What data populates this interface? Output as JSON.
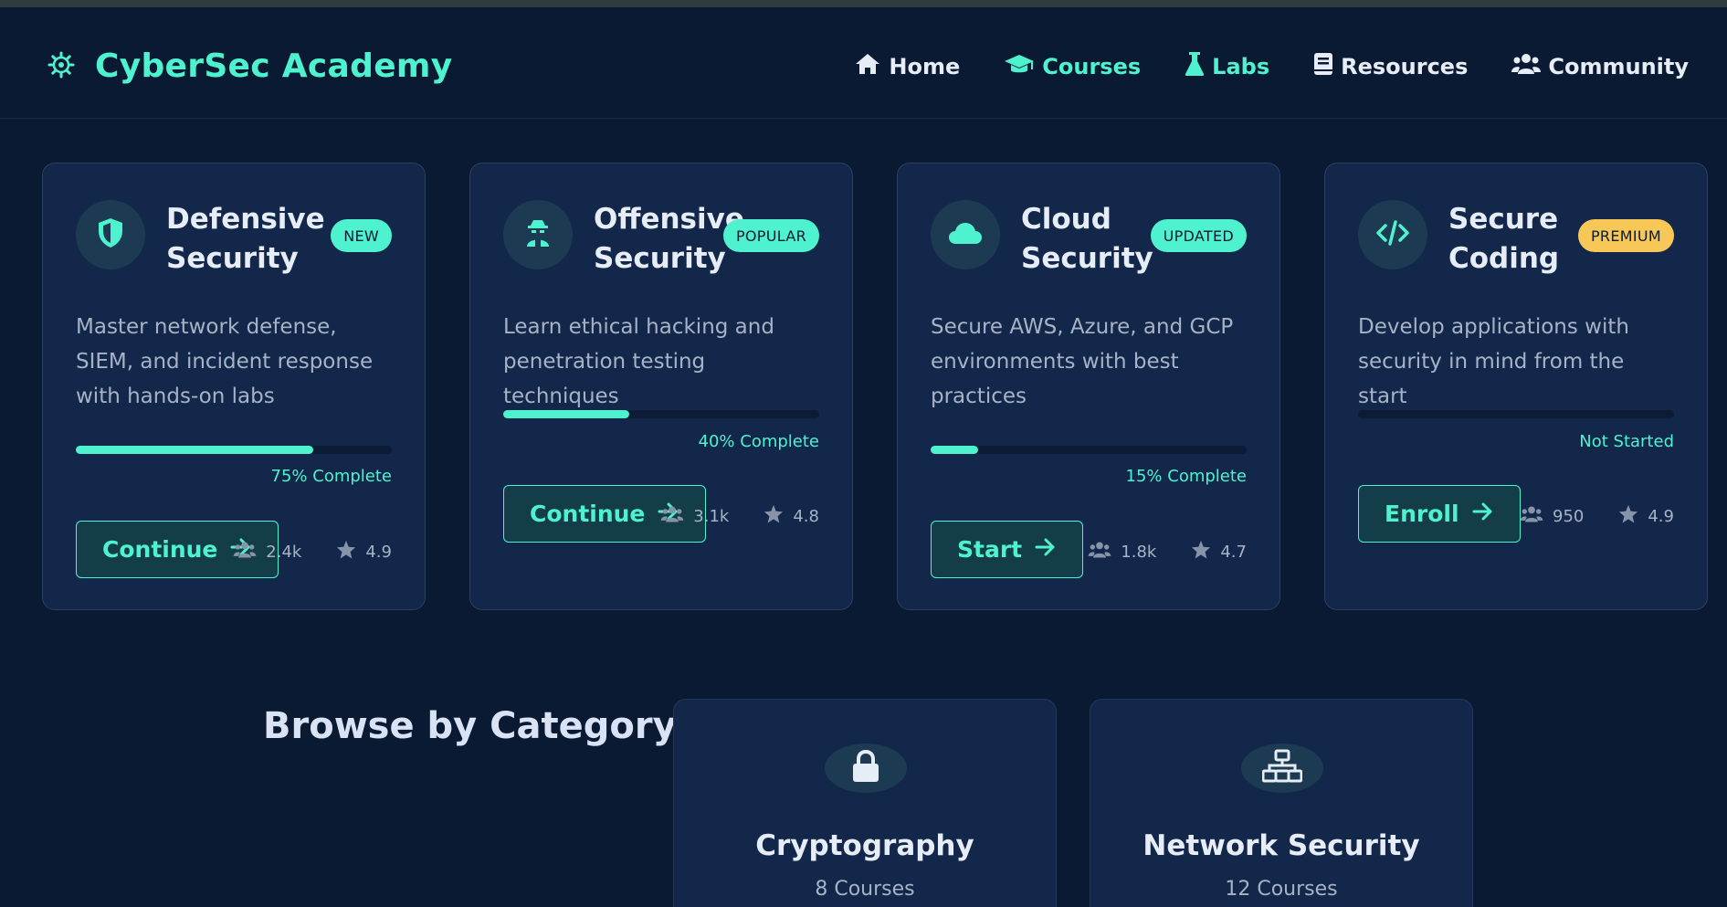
{
  "brand": {
    "title": "CyberSec Academy",
    "icon": "gear-icon"
  },
  "nav": [
    {
      "label": "Home",
      "icon": "home-icon",
      "active": false
    },
    {
      "label": "Courses",
      "icon": "graduation-cap-icon",
      "active": true
    },
    {
      "label": "Labs",
      "icon": "flask-icon",
      "active": true
    },
    {
      "label": "Resources",
      "icon": "book-icon",
      "active": false
    },
    {
      "label": "Community",
      "icon": "users-icon",
      "active": false
    }
  ],
  "courses": [
    {
      "title": "Defensive Security",
      "badge": "NEW",
      "icon": "shield-icon",
      "description": "Master network defense, SIEM, and incident response with hands-on labs",
      "progress": 0.75,
      "progress_label": "75% Complete",
      "button_label": "Continue",
      "students": "2.4k",
      "rating": "4.9"
    },
    {
      "title": "Offensive Security",
      "badge": "POPULAR",
      "icon": "hacker-icon",
      "description": "Learn ethical hacking and penetration testing techniques",
      "progress": 0.4,
      "progress_label": "40% Complete",
      "button_label": "Continue",
      "students": "3.1k",
      "rating": "4.8"
    },
    {
      "title": "Cloud Security",
      "badge": "UPDATED",
      "icon": "cloud-icon",
      "description": "Secure AWS, Azure, and GCP environments with best practices",
      "progress": 0.15,
      "progress_label": "15% Complete",
      "button_label": "Start",
      "students": "1.8k",
      "rating": "4.7"
    },
    {
      "title": "Secure Coding",
      "badge": "PREMIUM",
      "icon": "code-icon",
      "description": "Develop applications with security in mind from the start",
      "progress": 0,
      "progress_label": "Not Started",
      "button_label": "Enroll",
      "students": "950",
      "rating": "4.9"
    }
  ],
  "categories_section": {
    "title": "Browse by Category"
  },
  "categories": [
    {
      "name": "Cryptography",
      "count": "8 Courses",
      "icon": "lock-icon"
    },
    {
      "name": "Network Security",
      "count": "12 Courses",
      "icon": "network-icon"
    }
  ],
  "colors": {
    "accent": "#4ef2cf",
    "premium": "#f7c758",
    "background": "#0b1a33",
    "card": "#13274a"
  }
}
